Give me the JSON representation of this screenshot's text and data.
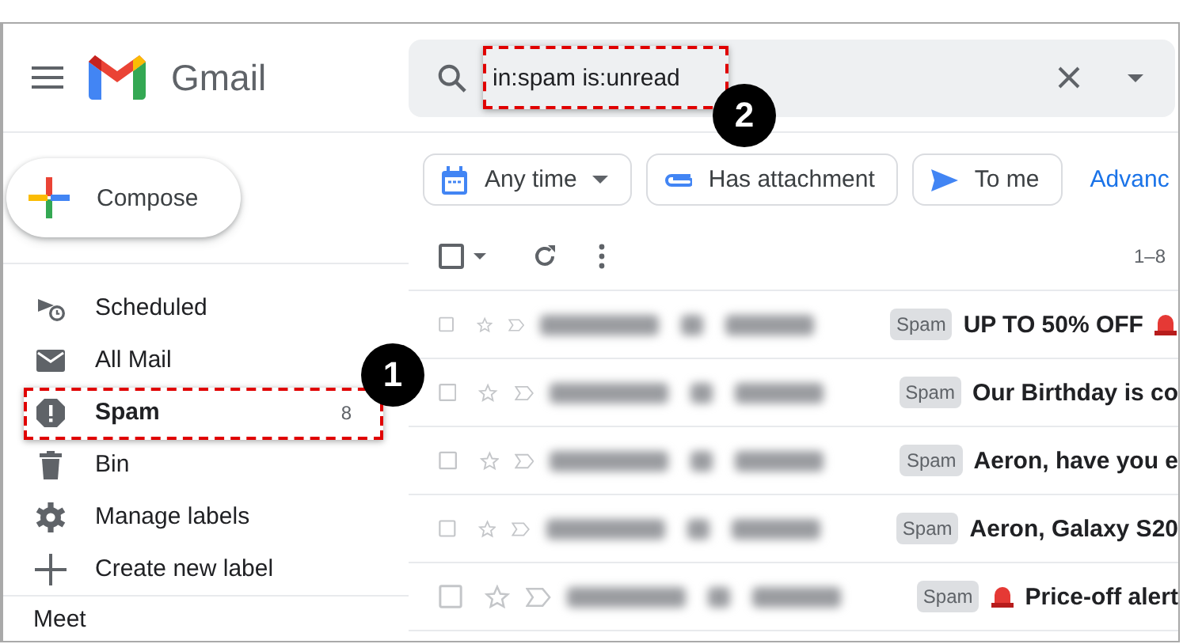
{
  "app": {
    "title": "Gmail"
  },
  "search": {
    "value": "in:spam is:unread"
  },
  "compose": {
    "label": "Compose"
  },
  "sidebar": {
    "items": [
      {
        "label": "Scheduled",
        "kind": "scheduled",
        "selected": false
      },
      {
        "label": "All Mail",
        "kind": "mail",
        "selected": false
      },
      {
        "label": "Spam",
        "kind": "spam",
        "count": "8",
        "selected": true
      },
      {
        "label": "Bin",
        "kind": "bin",
        "selected": false
      },
      {
        "label": "Manage labels",
        "kind": "gear",
        "selected": false
      },
      {
        "label": "Create new label",
        "kind": "plus",
        "selected": false
      }
    ],
    "footer": "Meet"
  },
  "chips": [
    {
      "label": "Any time",
      "kind": "date"
    },
    {
      "label": "Has attachment",
      "kind": "attachment"
    },
    {
      "label": "To me",
      "kind": "send"
    },
    {
      "label": "Advanc",
      "kind": "link"
    }
  ],
  "toolbar": {
    "range": "1–8"
  },
  "messages": [
    {
      "tag": "Spam",
      "subject": "UP TO 50% OFF",
      "kind": "trailing"
    },
    {
      "tag": "Spam",
      "subject": "Our Birthday is co",
      "kind": "plain"
    },
    {
      "tag": "Spam",
      "subject": "Aeron, have you e",
      "kind": "plain"
    },
    {
      "tag": "Spam",
      "subject": "Aeron, Galaxy S20",
      "kind": "plain"
    },
    {
      "tag": "Spam",
      "subject": "Price-off alert",
      "kind": "leading"
    }
  ],
  "callouts": [
    {
      "number": "1",
      "kind": "sidebar"
    },
    {
      "number": "2",
      "kind": "search"
    }
  ]
}
